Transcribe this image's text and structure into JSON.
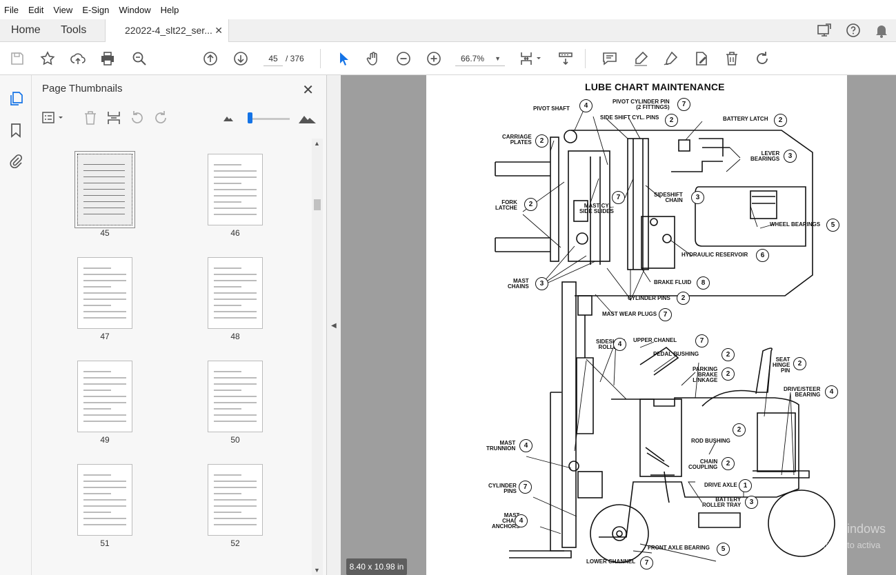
{
  "menu": [
    "File",
    "Edit",
    "View",
    "E-Sign",
    "Window",
    "Help"
  ],
  "tabs": {
    "home": "Home",
    "tools": "Tools",
    "document": "22022-4_slt22_ser...",
    "close_glyph": "✕"
  },
  "toolbar": {
    "page_current": "45",
    "page_total": "/ 376",
    "zoom": "66.7%"
  },
  "panel": {
    "title": "Page Thumbnails",
    "close_glyph": "✕"
  },
  "thumbnails": [
    {
      "label": "45",
      "selected": true
    },
    {
      "label": "46",
      "selected": false
    },
    {
      "label": "47",
      "selected": false
    },
    {
      "label": "48",
      "selected": false
    },
    {
      "label": "49",
      "selected": false
    },
    {
      "label": "50",
      "selected": false
    },
    {
      "label": "51",
      "selected": false
    },
    {
      "label": "52",
      "selected": false
    }
  ],
  "document": {
    "title": "LUBE CHART MAINTENANCE",
    "page_size": "8.40 x 10.98 in",
    "callouts": [
      {
        "text": "PIVOT SHAFT",
        "n": "4"
      },
      {
        "text": "PIVOT CYLINDER PIN\n(2 FITTINGS)",
        "n": "7"
      },
      {
        "text": "SIDE SHIFT CYL. PINS",
        "n": "2"
      },
      {
        "text": "BATTERY LATCH",
        "n": "2"
      },
      {
        "text": "CARRIAGE\nPLATES",
        "n": "2"
      },
      {
        "text": "LEVER\nBEARINGS",
        "n": "3"
      },
      {
        "text": "FORK\nLATCHE",
        "n": "2"
      },
      {
        "text": "MAST CYL.\nSIDE SLIDES",
        "n": "7"
      },
      {
        "text": "SIDESHIFT\nCHAIN",
        "n": "3"
      },
      {
        "text": "WHEEL BEARINGS",
        "n": "5"
      },
      {
        "text": "HYDRAULIC RESERVOIR",
        "n": "6"
      },
      {
        "text": "MAST\nCHAINS",
        "n": "3"
      },
      {
        "text": "BRAKE FLUID",
        "n": "8"
      },
      {
        "text": "CYLINDER PINS",
        "n": "2"
      },
      {
        "text": "MAST WEAR PLUGS",
        "n": "7"
      },
      {
        "text": "SIDESHIFT\nROLLERS",
        "n": "4"
      },
      {
        "text": "UPPER CHANEL",
        "n": "7"
      },
      {
        "text": "PEDAL BUSHING",
        "n": "2"
      },
      {
        "text": "SEAT\nHINGE\nPIN",
        "n": "2"
      },
      {
        "text": "PARKING\nBRAKE\nLINKAGE",
        "n": "2"
      },
      {
        "text": "DRIVE/STEER\nBEARING",
        "n": "4"
      },
      {
        "text": "ROD BUSHING",
        "n": "2"
      },
      {
        "text": "MAST\nTRUNNION",
        "n": "4"
      },
      {
        "text": "CHAIN\nCOUPLING",
        "n": "2"
      },
      {
        "text": "DRIVE AXLE",
        "n": "1"
      },
      {
        "text": "CYLINDER\nPINS",
        "n": "7"
      },
      {
        "text": "BATTERY\nROLLER TRAY",
        "n": "3"
      },
      {
        "text": "MAST\nCHAIN\nANCHORS",
        "n": "4"
      },
      {
        "text": "FRONT AXLE BEARING",
        "n": "5"
      },
      {
        "text": "LOWER CHANNEL",
        "n": "7"
      }
    ]
  },
  "watermark": {
    "line1": "Activate Windows",
    "line2": "Go to Settings to activa"
  },
  "colors": {
    "accent": "#1473e6",
    "doc_background": "#9e9e9e"
  }
}
